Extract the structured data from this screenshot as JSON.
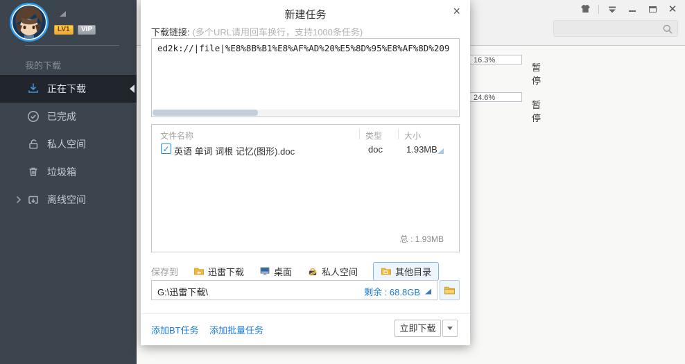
{
  "window": {
    "control_icons": [
      "theme-shirt",
      "minimize-to-tray",
      "minimize",
      "maximize",
      "close"
    ],
    "search_placeholder": ""
  },
  "user": {
    "level_badge": "LV1",
    "vip_badge": "VIP"
  },
  "sidebar": {
    "header": "我的下载",
    "items": [
      {
        "label": "正在下载",
        "icon": "download-arrow-icon",
        "active": true
      },
      {
        "label": "已完成",
        "icon": "check-circle-icon"
      },
      {
        "label": "私人空间",
        "icon": "lock-open-icon"
      },
      {
        "label": "垃圾箱",
        "icon": "trash-icon"
      },
      {
        "label": "离线空间",
        "icon": "offline-box-icon",
        "expandable": true
      }
    ]
  },
  "background_tasks": [
    {
      "percent": "16.3%",
      "status": "暂停"
    },
    {
      "percent": "24.6%",
      "status": "暂停"
    }
  ],
  "dialog": {
    "title": "新建任务",
    "close_glyph": "×",
    "link_label": "下载链接:",
    "link_hint": "(多个URL请用回车换行，支持1000条任务)",
    "url_value": "ed2k://|file|%E8%8B%B1%E8%AF%AD%20%E5%8D%95%E8%AF%8D%209",
    "file_table": {
      "headers": [
        "文件名称",
        "类型",
        "大小"
      ],
      "rows": [
        {
          "checked": "✓",
          "name": "英语 单词 词根 记忆(图形).doc",
          "type": "doc",
          "size": "1.93MB"
        }
      ],
      "total": "总 : 1.93MB"
    },
    "save_to_label": "保存到",
    "save_options": [
      {
        "label": "迅雷下载",
        "icon": "thunder-folder-icon"
      },
      {
        "label": "桌面",
        "icon": "desktop-icon"
      },
      {
        "label": "私人空间",
        "icon": "private-safe-icon"
      },
      {
        "label": "其他目录",
        "icon": "folder-icon",
        "selected": true
      }
    ],
    "path_value": "G:\\迅雷下载\\",
    "free_space": "剩余 : 68.8GB",
    "add_bt_link": "添加BT任务",
    "add_batch_link": "添加批量任务",
    "download_button": "立即下载"
  }
}
